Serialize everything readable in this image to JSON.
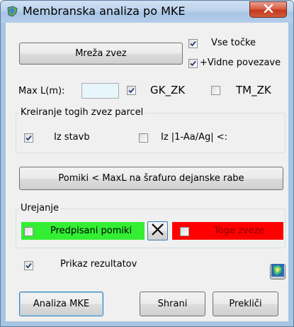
{
  "window": {
    "title": "Membranska analiza po MKE",
    "close_label": "X"
  },
  "top": {
    "mreza_button": "Mreža zvez",
    "vse_tocke": {
      "label": "Vse točke",
      "checked": true
    },
    "vidne_povezave": {
      "label": "+Vidne povezave",
      "checked": true
    }
  },
  "maxl": {
    "label": "Max L(m):",
    "value": "",
    "gk_zk": {
      "label": "GK_ZK",
      "checked": true
    },
    "tm_zk": {
      "label": "TM_ZK",
      "checked": false
    }
  },
  "kreiranje": {
    "legend": "Kreiranje togih zvez parcel",
    "iz_stavb": {
      "label": "Iz stavb",
      "checked": true
    },
    "iz_formula": {
      "label": "Iz |1-Aa/Ag| <:",
      "checked": false
    }
  },
  "pomiki_button": "Pomiki < MaxL na šrafuro dejanske rabe",
  "urejanje": {
    "legend": "Urejanje",
    "predpisani": {
      "label": "Predpisani pomiki",
      "checked": false,
      "color": "#33ee33"
    },
    "toge": {
      "label": "Toge zveze",
      "checked": false,
      "color": "#ff0000",
      "text_color": "#8b0000"
    }
  },
  "prikaz": {
    "label": "Prikaz rezultatov",
    "checked": true
  },
  "buttons": {
    "analiza": "Analiza MKE",
    "shrani": "Shrani",
    "preklici": "Prekliči"
  },
  "colors": {
    "title_gradient": "#bcd3ec",
    "client_bg": "#f0f0f0",
    "close_red": "#c4381c"
  }
}
